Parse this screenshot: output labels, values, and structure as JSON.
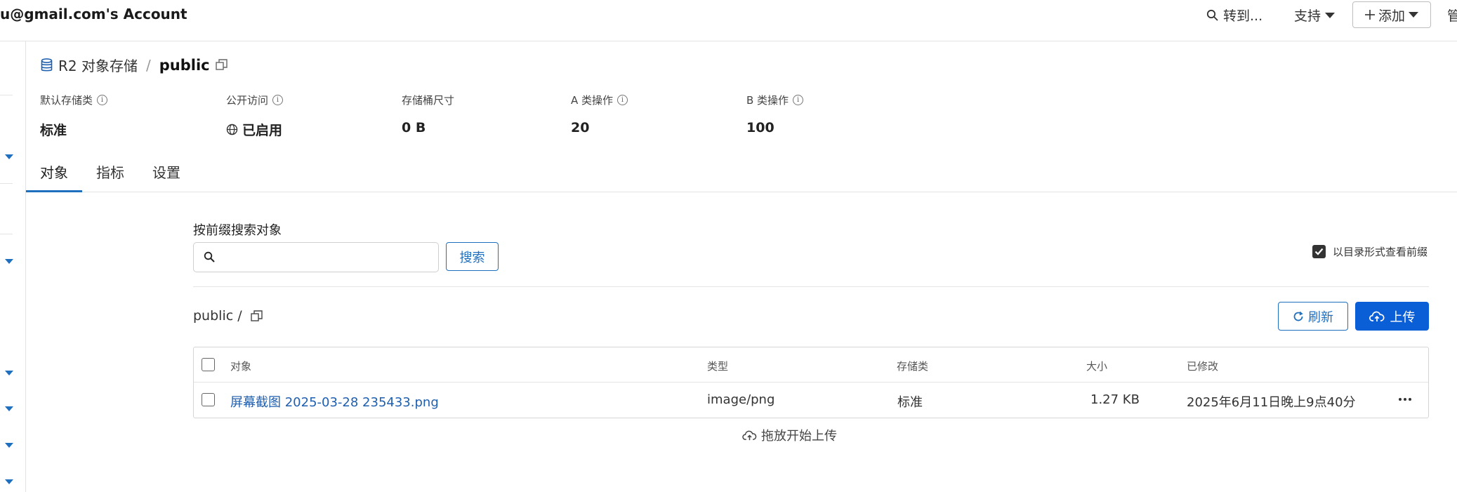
{
  "header": {
    "account": "u@gmail.com's Account",
    "goto_label": "转到...",
    "support_label": "支持",
    "add_label": "添加",
    "overflow_label": "管"
  },
  "breadcrumb": {
    "root": "R2 对象存储",
    "separator": "/",
    "current": "public"
  },
  "stats": [
    {
      "label": "默认存储类",
      "value": "标准"
    },
    {
      "label": "公开访问",
      "value": "已启用"
    },
    {
      "label": "存储桶尺寸",
      "value": "0 B"
    },
    {
      "label": "A 类操作",
      "value": "20"
    },
    {
      "label": "B 类操作",
      "value": "100"
    }
  ],
  "tabs": [
    "对象",
    "指标",
    "设置"
  ],
  "search": {
    "label": "按前缀搜索对象",
    "placeholder": "",
    "button": "搜索"
  },
  "directory_toggle": {
    "label": "以目录形式查看前缀",
    "checked": true
  },
  "path": "public /",
  "actions": {
    "refresh": "刷新",
    "upload": "上传"
  },
  "table": {
    "columns": [
      "对象",
      "类型",
      "存储类",
      "大小",
      "已修改"
    ],
    "rows": [
      {
        "name": "屏幕截图 2025-03-28 235433.png",
        "type": "image/png",
        "storage_class": "标准",
        "size": "1.27 KB",
        "modified": "2025年6月11日晚上9点40分"
      }
    ]
  },
  "dropzone": "拖放开始上传",
  "colors": {
    "accent": "#1f6fbf",
    "primary_button": "#0b5fd6",
    "link": "#1f5fb0"
  }
}
